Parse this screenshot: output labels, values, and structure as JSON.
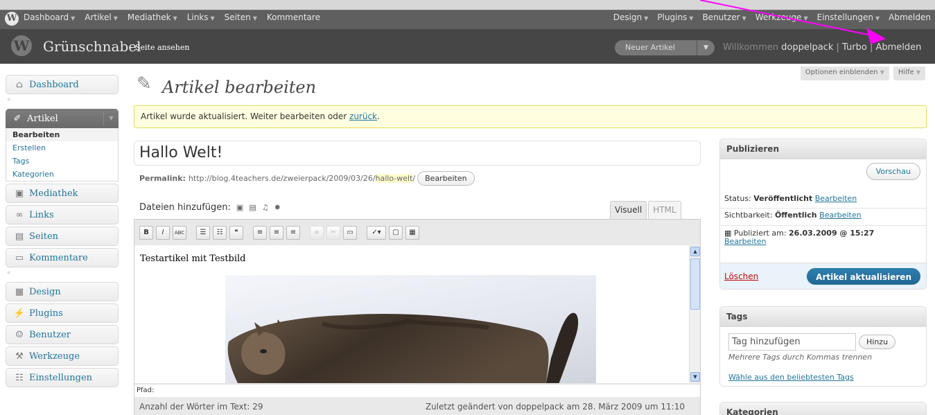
{
  "adminbar": {
    "left": [
      "Dashboard",
      "Artikel",
      "Mediathek",
      "Links",
      "Seiten",
      "Kommentare"
    ],
    "right": [
      "Design",
      "Plugins",
      "Benutzer",
      "Werkzeuge",
      "Einstellungen",
      "Abmelden"
    ]
  },
  "header": {
    "site_title": "Grünschnabel",
    "site_link": "– Seite ansehen",
    "new_post": "Neuer Artikel",
    "welcome": "Willkommen",
    "user": "doppelpack",
    "turbo": "Turbo",
    "logout": "Abmelden",
    "sep": "|"
  },
  "screen_tabs": {
    "options": "Optionen einblenden",
    "help": "Hilfe"
  },
  "sidebar": {
    "dashboard": "Dashboard",
    "artikel": "Artikel",
    "sub": [
      "Bearbeiten",
      "Erstellen",
      "Tags",
      "Kategorien"
    ],
    "group1": [
      "Mediathek",
      "Links",
      "Seiten",
      "Kommentare"
    ],
    "group2": [
      "Design",
      "Plugins",
      "Benutzer",
      "Werkzeuge",
      "Einstellungen"
    ]
  },
  "page": {
    "title": "Artikel bearbeiten",
    "notice": "Artikel wurde aktualisiert. Weiter bearbeiten oder",
    "notice_link": "zurück",
    "notice_end": "."
  },
  "post": {
    "title": "Hallo Welt!",
    "permalink_label": "Permalink:",
    "permalink_base": "http://blog.4teachers.de/zweierpack/2009/03/26/",
    "permalink_slug": "hallo-welt",
    "permalink_end": "/",
    "permalink_edit": "Bearbeiten",
    "media_label": "Dateien hinzufügen:",
    "tab_visual": "Visuell",
    "tab_html": "HTML",
    "content_text": "Testartikel mit Testbild",
    "path_label": "Pfad:",
    "word_count": "Anzahl der Wörter im Text: 29",
    "last_edit": "Zuletzt geändert von doppelpack am 28. März 2009 um 11:10"
  },
  "publish": {
    "heading": "Publizieren",
    "preview": "Vorschau",
    "status_label": "Status:",
    "status_value": "Veröffentlicht",
    "visibility_label": "Sichtbarkeit:",
    "visibility_value": "Öffentlich",
    "published_label": "Publiziert am:",
    "published_value": "26.03.2009 @ 15:27",
    "edit": "Bearbeiten",
    "delete": "Löschen",
    "update": "Artikel aktualisieren"
  },
  "tags": {
    "heading": "Tags",
    "placeholder": "Tag hinzufügen",
    "add": "Hinzu",
    "hint": "Mehrere Tags durch Kommas trennen",
    "choose": "Wähle aus den beliebtesten Tags"
  },
  "categories": {
    "heading": "Kategorien"
  },
  "colors": {
    "accent": "#21759b",
    "annotation": "#ff00ff"
  }
}
